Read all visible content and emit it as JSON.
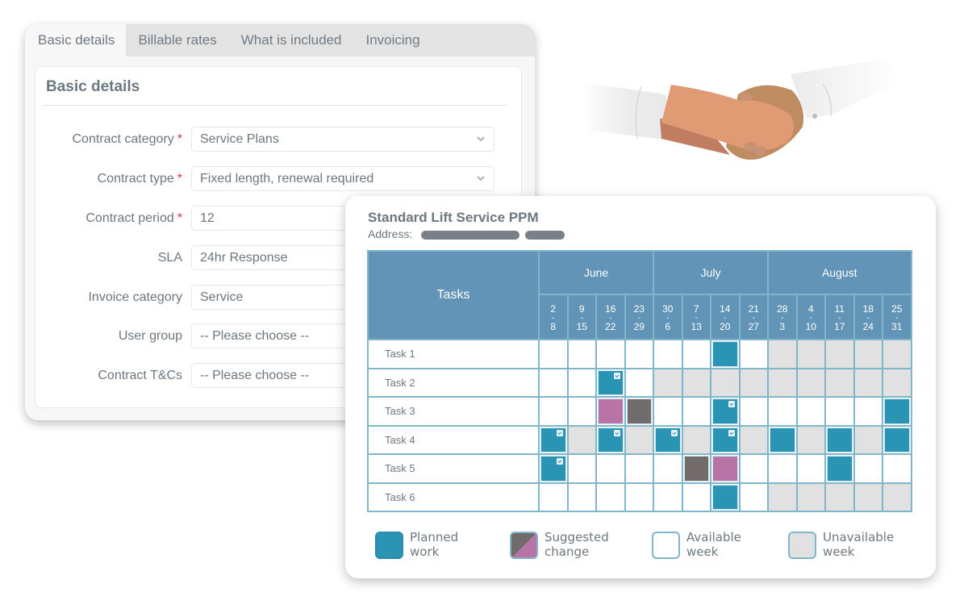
{
  "contract_form": {
    "tabs": [
      {
        "label": "Basic details",
        "active": true
      },
      {
        "label": "Billable rates",
        "active": false
      },
      {
        "label": "What is included",
        "active": false
      },
      {
        "label": "Invoicing",
        "active": false
      }
    ],
    "section_title": "Basic details",
    "fields": [
      {
        "label": "Contract category",
        "required": true,
        "value": "Service Plans",
        "type": "select"
      },
      {
        "label": "Contract type",
        "required": true,
        "value": "Fixed length, renewal required",
        "type": "select"
      },
      {
        "label": "Contract period",
        "required": true,
        "value": "12",
        "type": "input"
      },
      {
        "label": "SLA",
        "required": false,
        "value": "24hr Response",
        "type": "select"
      },
      {
        "label": "Invoice category",
        "required": false,
        "value": "Service",
        "type": "select"
      },
      {
        "label": "User group",
        "required": false,
        "value": "-- Please choose --",
        "type": "select"
      },
      {
        "label": "Contract T&Cs",
        "required": false,
        "value": "-- Please choose --",
        "type": "select"
      }
    ],
    "required_marker": "*"
  },
  "illustration": {
    "icon": "handshake-illustration"
  },
  "ppm": {
    "title": "Standard Lift Service PPM",
    "address_label": "Address:",
    "address_value": "redacted",
    "tasks_header": "Tasks",
    "months": [
      {
        "label": "June",
        "span": 4
      },
      {
        "label": "July",
        "span": 4
      },
      {
        "label": "August",
        "span": 5
      }
    ],
    "weeks": [
      {
        "start": "2",
        "end": "8"
      },
      {
        "start": "9",
        "end": "15"
      },
      {
        "start": "16",
        "end": "22"
      },
      {
        "start": "23",
        "end": "29"
      },
      {
        "start": "30",
        "end": "6"
      },
      {
        "start": "7",
        "end": "13"
      },
      {
        "start": "14",
        "end": "20"
      },
      {
        "start": "21",
        "end": "27"
      },
      {
        "start": "28",
        "end": "3"
      },
      {
        "start": "4",
        "end": "10"
      },
      {
        "start": "11",
        "end": "17"
      },
      {
        "start": "18",
        "end": "24"
      },
      {
        "start": "25",
        "end": "31"
      }
    ],
    "week_separator": "-",
    "cell_legend_codes": {
      "A": "available",
      "U": "unavailable",
      "P": "planned",
      "PC": "planned-completed",
      "SP": "suggested-to",
      "SG": "suggested-from"
    },
    "tasks": [
      {
        "name": "Task 1",
        "cells": [
          "A",
          "A",
          "A",
          "A",
          "A",
          "A",
          "P",
          "A",
          "U",
          "U",
          "U",
          "U",
          "U"
        ]
      },
      {
        "name": "Task 2",
        "cells": [
          "A",
          "A",
          "PC",
          "A",
          "U",
          "U",
          "U",
          "U",
          "U",
          "U",
          "U",
          "U",
          "U"
        ]
      },
      {
        "name": "Task 3",
        "cells": [
          "A",
          "A",
          "SP",
          "SG",
          "A",
          "A",
          "PC",
          "A",
          "A",
          "A",
          "A",
          "A",
          "P"
        ]
      },
      {
        "name": "Task 4",
        "cells": [
          "PC",
          "U",
          "PC",
          "U",
          "PC",
          "U",
          "PC",
          "U",
          "P",
          "U",
          "P",
          "U",
          "P"
        ]
      },
      {
        "name": "Task 5",
        "cells": [
          "PC",
          "A",
          "A",
          "A",
          "A",
          "SG",
          "SP",
          "A",
          "A",
          "A",
          "P",
          "A",
          "A"
        ]
      },
      {
        "name": "Task 6",
        "cells": [
          "A",
          "A",
          "A",
          "A",
          "A",
          "A",
          "P",
          "A",
          "U",
          "U",
          "U",
          "U",
          "U"
        ]
      }
    ],
    "legend": [
      {
        "key": "planned",
        "label_line1": "Planned",
        "label_line2": "work"
      },
      {
        "key": "suggested",
        "label_line1": "Suggested",
        "label_line2": "change"
      },
      {
        "key": "available",
        "label_line1": "Available",
        "label_line2": "week"
      },
      {
        "key": "unavailable",
        "label_line1": "Unavailable",
        "label_line2": "week"
      }
    ],
    "colors": {
      "header": "#6194b6",
      "planned": "#2a94b4",
      "suggested_to": "#b874a7",
      "suggested_from": "#716c6b",
      "unavailable": "#e1e1e1",
      "available": "#ffffff",
      "grid_border": "#7fb6cc"
    }
  }
}
